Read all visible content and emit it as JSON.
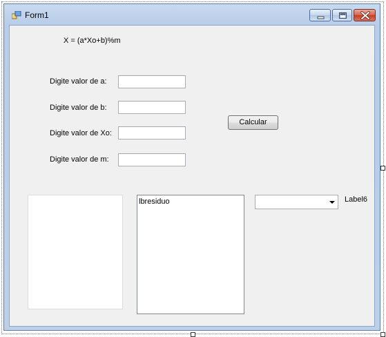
{
  "window": {
    "title": "Form1"
  },
  "form": {
    "formula": "X = (a*Xo+b)%m",
    "labels": {
      "a": "Digite valor de a:",
      "b": "Digite valor de b:",
      "xo": "Digite valor de Xo:",
      "m": "Digite valor de m:"
    },
    "inputs": {
      "a": "",
      "b": "",
      "xo": "",
      "m": ""
    },
    "calculate_button": "Calcular",
    "listbox_residuo_item": "lbresiduo",
    "combo_value": "",
    "label6": "Label6"
  },
  "colors": {
    "client_background": "#f0f0f0",
    "titlebar": "#c8daf0",
    "close_button": "#c53e25"
  },
  "icons": {
    "app": "form-app-icon",
    "minimize": "minimize-icon",
    "maximize": "maximize-icon",
    "close": "close-icon",
    "dropdown": "chevron-down-icon"
  }
}
